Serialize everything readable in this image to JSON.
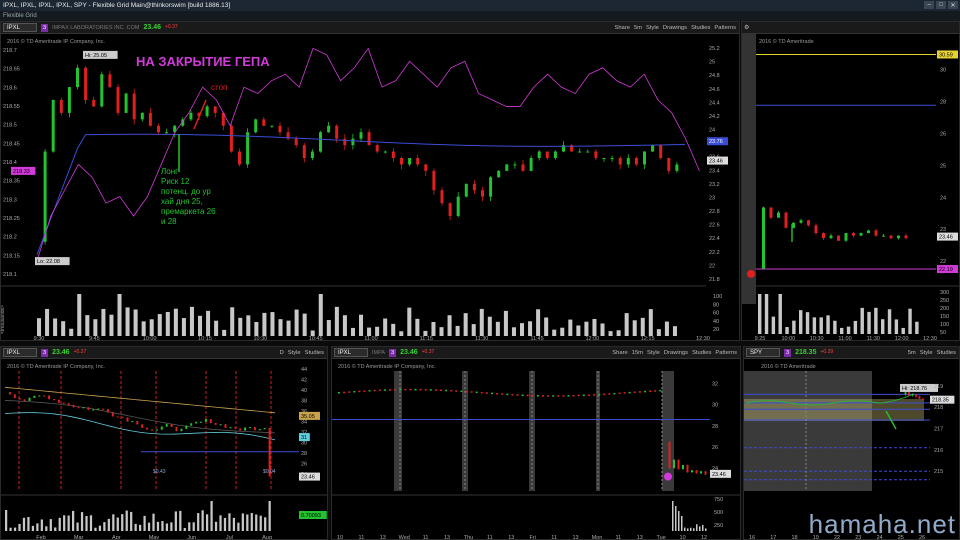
{
  "window": {
    "title": "IPXL, IPXL, IPXL, IPXL, SPY - Flexible Grid Main@thinkorswim [build 1886.13]",
    "subtitle": "Flexible Grid"
  },
  "main": {
    "symbol": "IPXL",
    "badge": "3",
    "company": "IMPAX LABORATORIES INC. COM",
    "price": "23.46",
    "change": "+0.37",
    "buttons": [
      "Share",
      "5m",
      "Style",
      "Drawings",
      "Studies",
      "Patterns"
    ],
    "copyright": "2016 © TD Ameritrade IP Company, Inc.",
    "headline": "НА ЗАКРЫТИЕ ГЕПА",
    "stop_label": "стоп",
    "note": [
      "Лонг",
      "Риск 12",
      "потенц. до ур",
      "хай дня 25,",
      "премаркета 26",
      "и 28"
    ],
    "hi_label": "Hi: 25.05",
    "lo_label": "Lo: 22.08",
    "y_ticks": [
      "218.7",
      "218.65",
      "218.6",
      "218.55",
      "218.5",
      "218.45",
      "218.4",
      "218.35",
      "218.3",
      "218.25",
      "218.2",
      "218.15",
      "218.1"
    ],
    "y_ticks_right": [
      "25.2",
      "25",
      "24.8",
      "24.6",
      "24.4",
      "24.2",
      "24",
      "23.8",
      "23.6",
      "23.4",
      "23.2",
      "23",
      "22.8",
      "22.6",
      "22.4",
      "22.2",
      "22",
      "21.8"
    ],
    "spy_tag": "218.33",
    "price_tag": "23.76",
    "last_tag": "23.46",
    "vol_ticks": [
      "100",
      "80",
      "60",
      "40",
      "20"
    ],
    "vol_label": "<thousands>",
    "x_ticks": [
      "9:30",
      "9:45",
      "10:00",
      "10:15",
      "10:30",
      "10:45",
      "11:00",
      "11:15",
      "11:30",
      "11:45",
      "12:00",
      "12:15",
      "12:30"
    ]
  },
  "topright": {
    "copyright": "2016 © TD Ameritrade",
    "y_ticks": [
      "30",
      "28",
      "26",
      "25",
      "24",
      "23",
      "22"
    ],
    "tag_top": "30.59",
    "tag_bottom": "22.19",
    "last_tag": "23.46",
    "vol_ticks": [
      "300",
      "250",
      "200",
      "150",
      "100",
      "50"
    ],
    "vol_label": "<thousands>",
    "x_ticks": [
      "9:25",
      "10:00",
      "10:30",
      "11:00",
      "11:30",
      "12:00",
      "12:30"
    ]
  },
  "bottomleft": {
    "symbol": "IPXL",
    "badge": "3",
    "price": "23.46",
    "change": "+0.37",
    "buttons": [
      "D",
      "Style",
      "Studies"
    ],
    "copyright": "2016 © TD Ameritrade IP Company, Inc.",
    "y_ticks": [
      "44",
      "42",
      "40",
      "38",
      "36",
      "34",
      "32",
      "30",
      "28",
      "26",
      "24"
    ],
    "tag_a": "35.05",
    "tag_b": "31",
    "last_tag": "23.46",
    "event_labels": [
      "$0.43",
      "$0.04"
    ],
    "vol_tag": "0.70093",
    "vol_label": "<millions>",
    "x_ticks": [
      "Feb",
      "Mar",
      "Apr",
      "May",
      "Jun",
      "Jul",
      "Aug"
    ]
  },
  "bottommid": {
    "symbol": "IPXL",
    "company": "IMPA",
    "badge": "3",
    "price": "23.46",
    "change": "+0.37",
    "buttons": [
      "Share",
      "15m",
      "Style",
      "Drawings",
      "Studies",
      "Patterns"
    ],
    "copyright": "2016 © TD Ameritrade IP Company, Inc.",
    "y_ticks": [
      "32",
      "30",
      "28",
      "26",
      "24"
    ],
    "last_tag": "23.46",
    "vol_ticks": [
      "750",
      "500",
      "250"
    ],
    "vol_label": "<thousands>",
    "x_ticks": [
      "10",
      "11",
      "13",
      "Wed",
      "11",
      "13",
      "Thu",
      "11",
      "13",
      "Fri",
      "11",
      "13",
      "Mon",
      "11",
      "13",
      "Tue",
      "10",
      "12"
    ]
  },
  "bottomright": {
    "symbol": "SPY",
    "badge": "3",
    "price": "218.35",
    "change": "+0.29",
    "buttons": [
      "5m",
      "Style",
      "Studies"
    ],
    "copyright": "2016 © TD Ameritrade",
    "hi_label": "Hi: 218.76",
    "y_ticks": [
      "219",
      "218",
      "217",
      "216",
      "215"
    ],
    "last_tag": "218.35",
    "x_ticks": [
      "16",
      "17",
      "18",
      "19",
      "22",
      "23",
      "24",
      "25",
      "26"
    ]
  },
  "watermark": "hamaha.net"
}
